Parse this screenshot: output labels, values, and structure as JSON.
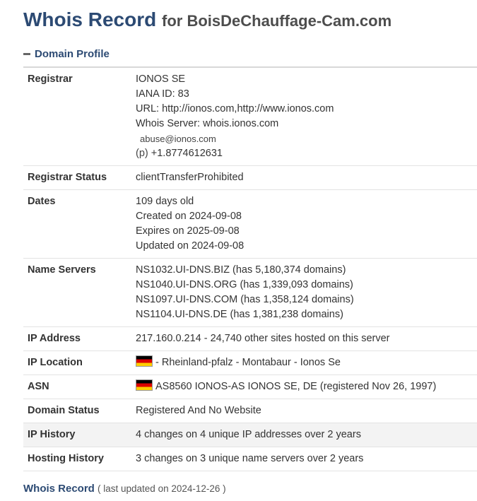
{
  "title": {
    "main": "Whois Record",
    "sub": "for BoisDeChauffage-Cam.com"
  },
  "section": {
    "label": "Domain Profile"
  },
  "rows": [
    {
      "label": "Registrar",
      "lines": [
        "IONOS SE",
        "IANA ID: 83",
        "URL: http://ionos.com,http://www.ionos.com",
        "Whois Server: whois.ionos.com"
      ],
      "email": "abuse@ionos.com",
      "phone_prefix": "(p)",
      "phone": "+1.8774612631"
    },
    {
      "label": "Registrar Status",
      "lines": [
        "clientTransferProhibited"
      ]
    },
    {
      "label": "Dates",
      "lines": [
        "109 days old",
        "Created on 2024-09-08",
        "Expires on 2025-09-08",
        "Updated on 2024-09-08"
      ]
    },
    {
      "label": "Name Servers",
      "lines": [
        "NS1032.UI-DNS.BIZ (has 5,180,374 domains)",
        "NS1040.UI-DNS.ORG (has 1,339,093 domains)",
        "NS1097.UI-DNS.COM (has 1,358,124 domains)",
        "NS1104.UI-DNS.DE (has 1,381,238 domains)"
      ]
    },
    {
      "label": "IP Address",
      "lines": [
        "217.160.0.214 - 24,740 other sites hosted on this server"
      ]
    },
    {
      "label": "IP Location",
      "lines": [
        "- Rheinland-pfalz - Montabaur - Ionos Se"
      ],
      "flag": true
    },
    {
      "label": "ASN",
      "lines": [
        "AS8560 IONOS-AS IONOS SE, DE (registered Nov 26, 1997)"
      ],
      "flag": true
    },
    {
      "label": "Domain Status",
      "lines": [
        "Registered And No Website"
      ]
    },
    {
      "label": "IP History",
      "lines": [
        "4 changes on 4 unique IP addresses over 2 years"
      ],
      "shaded": true
    },
    {
      "label": "Hosting History",
      "lines": [
        "3 changes on 3 unique name servers over 2 years"
      ]
    }
  ],
  "footer": {
    "link": "Whois Record",
    "updated": "( last updated on 2024-12-26 )"
  }
}
